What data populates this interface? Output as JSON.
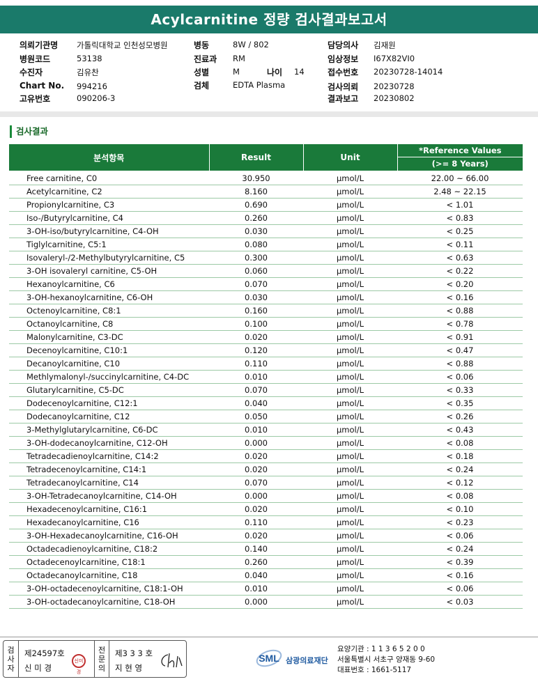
{
  "header": {
    "title": "Acylcarnitine 정량 검사결과보고서"
  },
  "info": {
    "col1": [
      {
        "label": "의뢰기관명",
        "value": "가톨릭대학교 인천성모병원"
      },
      {
        "label": "병원코드",
        "value": "53138"
      },
      {
        "label": "수진자",
        "value": "김유찬"
      },
      {
        "label": "Chart No.",
        "value": "994216"
      },
      {
        "label": "고유번호",
        "value": "090206-3"
      }
    ],
    "col2": [
      {
        "label": "병동",
        "value": "8W / 802"
      },
      {
        "label": "진료과",
        "value": "RM"
      },
      {
        "label": "성별",
        "value": "M"
      },
      {
        "label": "검체",
        "value": "EDTA Plasma"
      }
    ],
    "age": {
      "label": "나이",
      "value": "14"
    },
    "col3": [
      {
        "label": "담당의사",
        "value": "김재원"
      },
      {
        "label": "임상정보",
        "value": "I67X82VI0"
      },
      {
        "label": "접수번호",
        "value": "20230728-14014"
      },
      {
        "label": "검사의뢰",
        "value": "20230728"
      },
      {
        "label": "결과보고",
        "value": "20230802"
      }
    ]
  },
  "section_title": "검사결과",
  "table": {
    "headers": {
      "item": "분석항목",
      "result": "Result",
      "unit": "Unit",
      "ref_line1": "*Reference Values",
      "ref_line2": "(>= 8 Years)"
    },
    "rows": [
      {
        "name": "Free carnitine, C0",
        "result": "30.950",
        "unit": "μmol/L",
        "ref": "22.00 ~ 66.00"
      },
      {
        "name": "Acetylcarnitine, C2",
        "result": "8.160",
        "unit": "μmol/L",
        "ref": "2.48 ~ 22.15"
      },
      {
        "name": "Propionylcarnitine, C3",
        "result": "0.690",
        "unit": "μmol/L",
        "ref": "< 1.01"
      },
      {
        "name": "Iso-/Butyrylcarnitine, C4",
        "result": "0.260",
        "unit": "μmol/L",
        "ref": "< 0.83"
      },
      {
        "name": "3-OH-iso/butyrylcarnitine, C4-OH",
        "result": "0.030",
        "unit": "μmol/L",
        "ref": "< 0.25"
      },
      {
        "name": "Tiglylcarnitine, C5:1",
        "result": "0.080",
        "unit": "μmol/L",
        "ref": "< 0.11"
      },
      {
        "name": "Isovaleryl-/2-Methylbutyrylcarnitine, C5",
        "result": "0.300",
        "unit": "μmol/L",
        "ref": "< 0.63"
      },
      {
        "name": "3-OH isovaleryl carnitine, C5-OH",
        "result": "0.060",
        "unit": "μmol/L",
        "ref": "< 0.22"
      },
      {
        "name": "Hexanoylcarnitine, C6",
        "result": "0.070",
        "unit": "μmol/L",
        "ref": "< 0.20"
      },
      {
        "name": "3-OH-hexanoylcarnitine, C6-OH",
        "result": "0.030",
        "unit": "μmol/L",
        "ref": "< 0.16"
      },
      {
        "name": "Octenoylcarnitine, C8:1",
        "result": "0.160",
        "unit": "μmol/L",
        "ref": "< 0.88"
      },
      {
        "name": "Octanoylcarnitine, C8",
        "result": "0.100",
        "unit": "μmol/L",
        "ref": "< 0.78"
      },
      {
        "name": "Malonylcarnitine, C3-DC",
        "result": "0.020",
        "unit": "μmol/L",
        "ref": "< 0.91"
      },
      {
        "name": "Decenoylcarnitine, C10:1",
        "result": "0.120",
        "unit": "μmol/L",
        "ref": "< 0.47"
      },
      {
        "name": "Decanoylcarnitine, C10",
        "result": "0.110",
        "unit": "μmol/L",
        "ref": "< 0.88"
      },
      {
        "name": "Methlymalonyl-/succinylcarnitine, C4-DC",
        "result": "0.010",
        "unit": "μmol/L",
        "ref": "< 0.06"
      },
      {
        "name": "Glutarylcarnitine, C5-DC",
        "result": "0.070",
        "unit": "μmol/L",
        "ref": "< 0.33"
      },
      {
        "name": "Dodecenoylcarnitine, C12:1",
        "result": "0.040",
        "unit": "μmol/L",
        "ref": "< 0.35"
      },
      {
        "name": "Dodecanoylcarnitine, C12",
        "result": "0.050",
        "unit": "μmol/L",
        "ref": "< 0.26"
      },
      {
        "name": "3-Methylglutarylcarnitine, C6-DC",
        "result": "0.010",
        "unit": "μmol/L",
        "ref": "< 0.43"
      },
      {
        "name": "3-OH-dodecanoylcarnitine, C12-OH",
        "result": "0.000",
        "unit": "μmol/L",
        "ref": "< 0.08"
      },
      {
        "name": "Tetradecadienoylcarnitine, C14:2",
        "result": "0.020",
        "unit": "μmol/L",
        "ref": "< 0.18"
      },
      {
        "name": "Tetradecenoylcarnitine, C14:1",
        "result": "0.020",
        "unit": "μmol/L",
        "ref": "< 0.24"
      },
      {
        "name": "Tetradecanoylcarnitine, C14",
        "result": "0.070",
        "unit": "μmol/L",
        "ref": "< 0.12"
      },
      {
        "name": "3-OH-Tetradecanoylcarnitine, C14-OH",
        "result": "0.000",
        "unit": "μmol/L",
        "ref": "< 0.08"
      },
      {
        "name": "Hexadecenoylcarnitine, C16:1",
        "result": "0.020",
        "unit": "μmol/L",
        "ref": "< 0.10"
      },
      {
        "name": "Hexadecanoylcarnitine, C16",
        "result": "0.110",
        "unit": "μmol/L",
        "ref": "< 0.23"
      },
      {
        "name": "3-OH-Hexadecanoylcarnitine, C16-OH",
        "result": "0.020",
        "unit": "μmol/L",
        "ref": "< 0.06"
      },
      {
        "name": "Octadecadienoylcarnitine, C18:2",
        "result": "0.140",
        "unit": "μmol/L",
        "ref": "< 0.24"
      },
      {
        "name": "Octadecenoylcarnitine, C18:1",
        "result": "0.260",
        "unit": "μmol/L",
        "ref": "< 0.39"
      },
      {
        "name": "Octadecanoylcarnitine, C18",
        "result": "0.040",
        "unit": "μmol/L",
        "ref": "< 0.16"
      },
      {
        "name": "3-OH-octadecenoylcarnitine, C18:1-OH",
        "result": "0.010",
        "unit": "μmol/L",
        "ref": "< 0.06"
      },
      {
        "name": "3-OH-octadecanoylcarnitine, C18-OH",
        "result": "0.000",
        "unit": "μmol/L",
        "ref": "< 0.03"
      }
    ]
  },
  "footer": {
    "examiner": {
      "v1": "검",
      "v2": "사",
      "v3": "자",
      "license": "제24597호",
      "name": "신 미 경",
      "stamp": "신미경"
    },
    "specialist": {
      "v1": "전",
      "v2": "문",
      "v3": "의",
      "license": "제3 3 3 호",
      "name": "지 현 영",
      "signature": "Chi"
    },
    "org": {
      "logo_text": "SML",
      "name": "삼광의료재단",
      "code": "요양기관 : 1 1 3 6 5 2 0 0",
      "address": "서울특별시 서초구 양재동 9-60",
      "phone": "대표번호 : 1661-5117"
    }
  },
  "colors": {
    "title_bg": "#1a7a6a",
    "table_header_bg": "#1a7a3a",
    "row_line": "#9cc9a5",
    "logo_blue": "#1f5aa0"
  }
}
